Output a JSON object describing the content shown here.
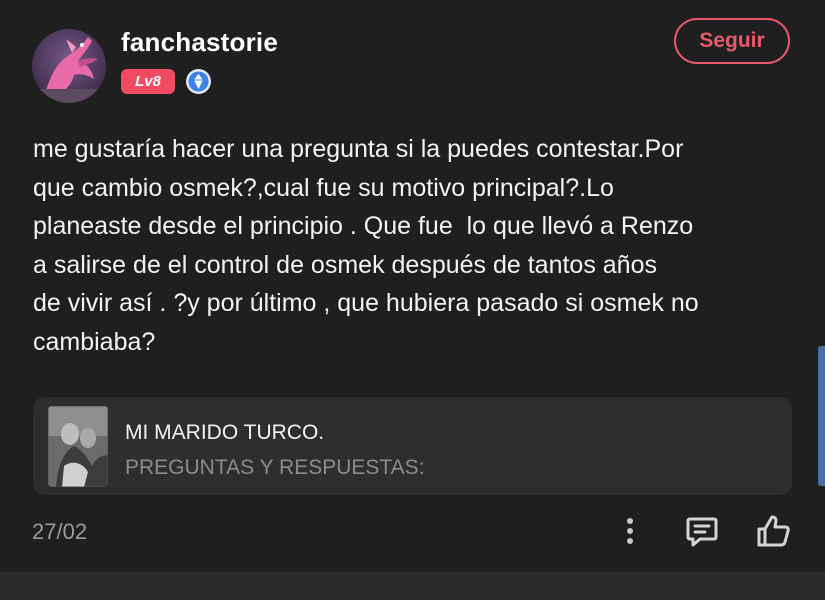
{
  "comment": {
    "username": "fanchastorie",
    "level_badge": "Lv8",
    "follow_label": "Seguir",
    "text": "me gustaría hacer una pregunta si la puedes contestar.Por\nque cambio osmek?,cual fue su motivo principal?.Lo\nplaneaste desde el principio . Que fue  lo que llevó a Renzo\na salirse de el control de osmek después de tantos años\nde vivir así . ?y por último , que hubiera pasado si osmek no\ncambiaba?",
    "date": "27/02"
  },
  "story": {
    "title": "MI MARIDO TURCO.",
    "chapter": "PREGUNTAS Y RESPUESTAS:"
  },
  "icons": {
    "verify": "diamond-verified-icon",
    "more": "more-vertical-icon",
    "reply": "comment-reply-icon",
    "like": "thumbs-up-icon"
  },
  "colors": {
    "background": "#1f1f1f",
    "accent": "#e9596c",
    "level_badge": "#f04b61",
    "verify_badge": "#3d82e6",
    "story_card": "#2e2e2e",
    "muted_text": "#8c8c8c"
  }
}
